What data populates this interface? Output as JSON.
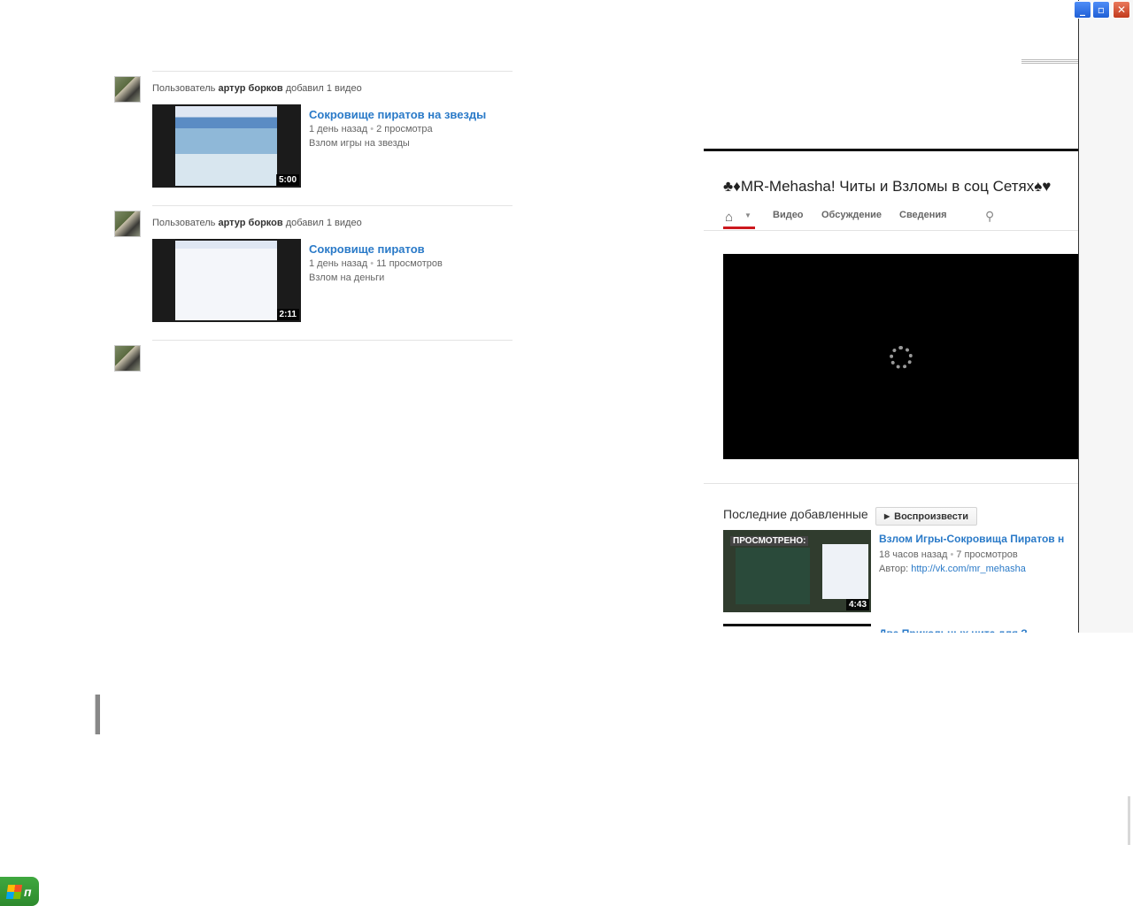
{
  "window_controls": {
    "minimize": "_",
    "maximize": "▫",
    "close": "✕"
  },
  "feed": {
    "items": [
      {
        "prefix": "Пользователь",
        "user": "артур борков",
        "action": "добавил 1 видео",
        "duration": "5:00",
        "title": "Сокровище пиратов на звезды",
        "age": "1 день назад",
        "views": "2 просмотра",
        "description": "Взлом игры на звезды"
      },
      {
        "prefix": "Пользователь",
        "user": "артур борков",
        "action": "добавил 1 видео",
        "duration": "2:11",
        "title": "Сокровище пиратов",
        "age": "1 день назад",
        "views": "11 просмотров",
        "description": "Взлом на деньги"
      }
    ]
  },
  "channel": {
    "title": "♣♦MR-Mehasha! Читы и Взломы в соц Сетях♠♥",
    "nav": {
      "home_icon": "home-icon",
      "tabs": [
        "Видео",
        "Обсуждение",
        "Сведения"
      ],
      "search_icon": "search-icon"
    },
    "recent": {
      "label": "Последние добавленные",
      "play_button": "Воспроизвести",
      "video": {
        "watched_badge": "ПРОСМОТРЕНО:",
        "duration": "4:43",
        "title": "Взлом Игры-Сокровища Пиратов н",
        "age": "18 часов назад",
        "views": "7 просмотров",
        "author_label": "Автор:",
        "author_link": "http://vk.com/mr_mehasha"
      },
      "next_title": "Два Прикольных чита для З"
    }
  },
  "taskbar": {
    "start_label": "п"
  }
}
